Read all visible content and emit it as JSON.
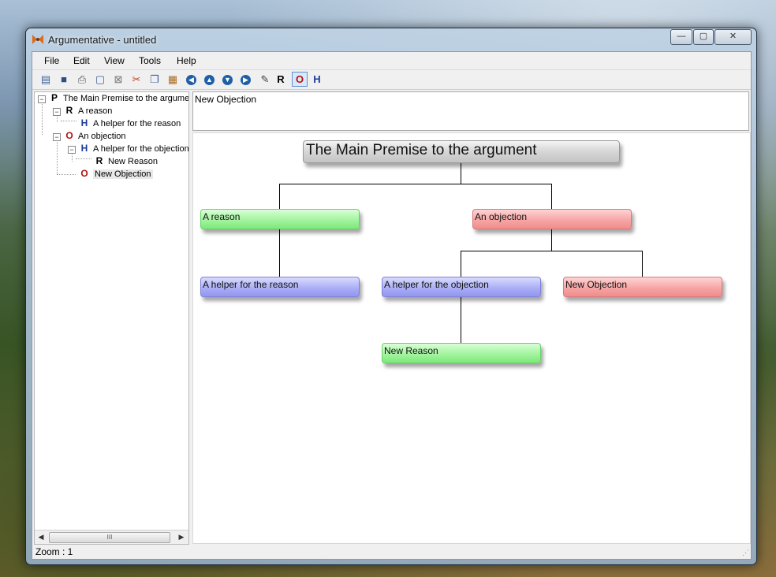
{
  "window": {
    "title": "Argumentative - untitled",
    "controls": {
      "minimize": "—",
      "maximize": "▢",
      "close": "✕"
    }
  },
  "menu": [
    "File",
    "Edit",
    "View",
    "Tools",
    "Help"
  ],
  "toolbar": {
    "icons": [
      "new-icon",
      "save-icon",
      "print-icon",
      "print-preview-icon",
      "delete-icon",
      "cut-icon",
      "copy-icon",
      "paste-icon",
      "arrow-left-icon",
      "arrow-up-icon",
      "arrow-down-icon",
      "arrow-right-icon",
      "edit-icon"
    ],
    "add_reason": "R",
    "add_objection": "O",
    "add_helper": "H"
  },
  "tree": {
    "items": [
      {
        "type": "P",
        "label": "The Main Premise to the argumer"
      },
      {
        "type": "R",
        "label": "A reason"
      },
      {
        "type": "H",
        "label": "A helper for the reason"
      },
      {
        "type": "O",
        "label": "An objection"
      },
      {
        "type": "H",
        "label": "A helper for the objection"
      },
      {
        "type": "R",
        "label": "New Reason"
      },
      {
        "type": "O",
        "label": "New Objection"
      }
    ],
    "scroll_grip": "III"
  },
  "editor": {
    "text": "New Objection"
  },
  "diagram": {
    "premise": "The Main Premise to the argument",
    "reason": "A reason",
    "objection": "An objection",
    "helper_reason": "A helper for the reason",
    "helper_objection": "A helper for the objection",
    "new_objection": "New Objection",
    "new_reason": "New Reason"
  },
  "status": {
    "zoom": "Zoom : 1"
  },
  "colors": {
    "premise": "#d0d0d0",
    "reason": "#9ef39a",
    "objection": "#f6a2a2",
    "helper": "#a8abf5",
    "letter_reason": "#000000",
    "letter_objection": "#b01010",
    "letter_helper": "#1a3a9a"
  }
}
